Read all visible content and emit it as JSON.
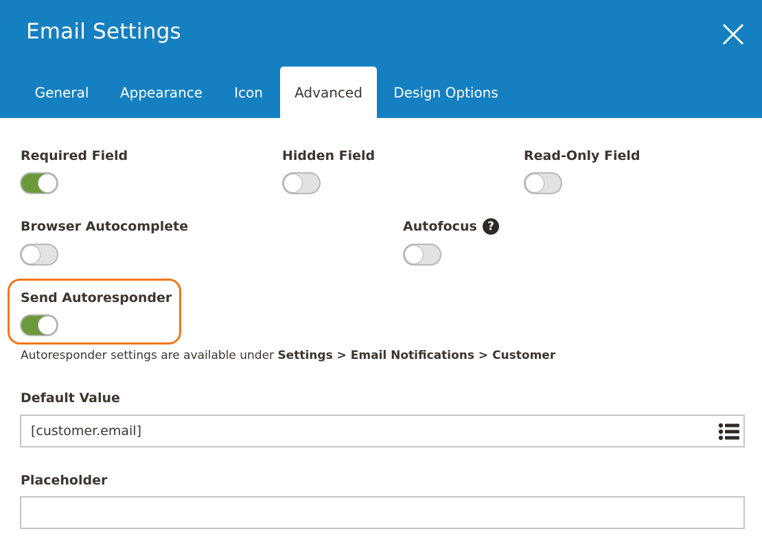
{
  "dialog": {
    "title": "Email Settings",
    "close_icon": "close-icon"
  },
  "tabs": [
    {
      "label": "General",
      "active": false
    },
    {
      "label": "Appearance",
      "active": false
    },
    {
      "label": "Icon",
      "active": false
    },
    {
      "label": "Advanced",
      "active": true
    },
    {
      "label": "Design Options",
      "active": false
    }
  ],
  "toggles": {
    "required_field": {
      "label": "Required Field",
      "on": true
    },
    "hidden_field": {
      "label": "Hidden Field",
      "on": false
    },
    "read_only_field": {
      "label": "Read-Only Field",
      "on": false
    },
    "browser_autocomplete": {
      "label": "Browser Autocomplete",
      "on": false
    },
    "autofocus": {
      "label": "Autofocus",
      "on": false,
      "help_icon": "?"
    },
    "send_autoresponder": {
      "label": "Send Autoresponder",
      "on": true
    }
  },
  "autoresponder_note": {
    "text": "Autoresponder settings are available under ",
    "path": "Settings > Email Notifications > Customer"
  },
  "default_value": {
    "label": "Default Value",
    "value": "[customer.email]",
    "icon": "list-icon"
  },
  "placeholder": {
    "label": "Placeholder",
    "value": ""
  },
  "colors": {
    "header": "#1580c1",
    "toggle_on": "#6c9a3b",
    "highlight": "#f07618"
  }
}
